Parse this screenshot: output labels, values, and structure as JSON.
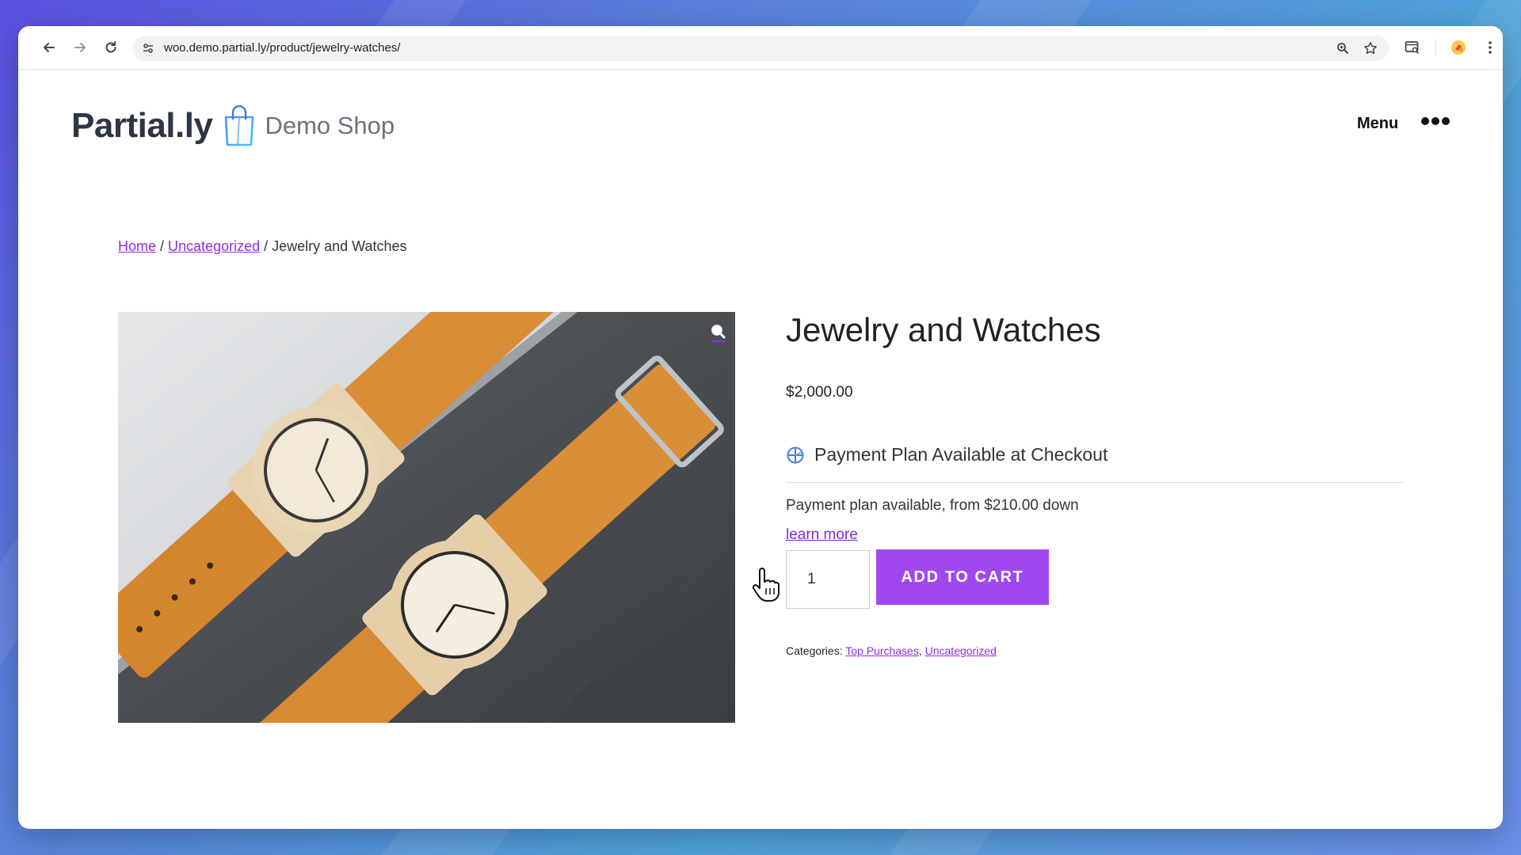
{
  "browser": {
    "url": "woo.demo.partial.ly/product/jewelry-watches/"
  },
  "header": {
    "brand": "Partial.ly",
    "subtitle": "Demo Shop",
    "menu_label": "Menu"
  },
  "breadcrumb": {
    "home": "Home",
    "sep1": " / ",
    "category": "Uncategorized",
    "sep2": " / ",
    "current": "Jewelry and Watches"
  },
  "product": {
    "title": "Jewelry and Watches",
    "price": "$2,000.00",
    "payment_plan_title": "Payment Plan Available at Checkout",
    "payment_plan_sub": "Payment plan available, from $210.00 down",
    "learn_more": "learn more",
    "quantity": "1",
    "add_to_cart": "ADD TO CART",
    "categories_label": "Categories: ",
    "categories": [
      "Top Purchases",
      "Uncategorized"
    ],
    "categories_sep": ", "
  },
  "colors": {
    "accent": "#a048f0",
    "link": "#8e2de2"
  }
}
